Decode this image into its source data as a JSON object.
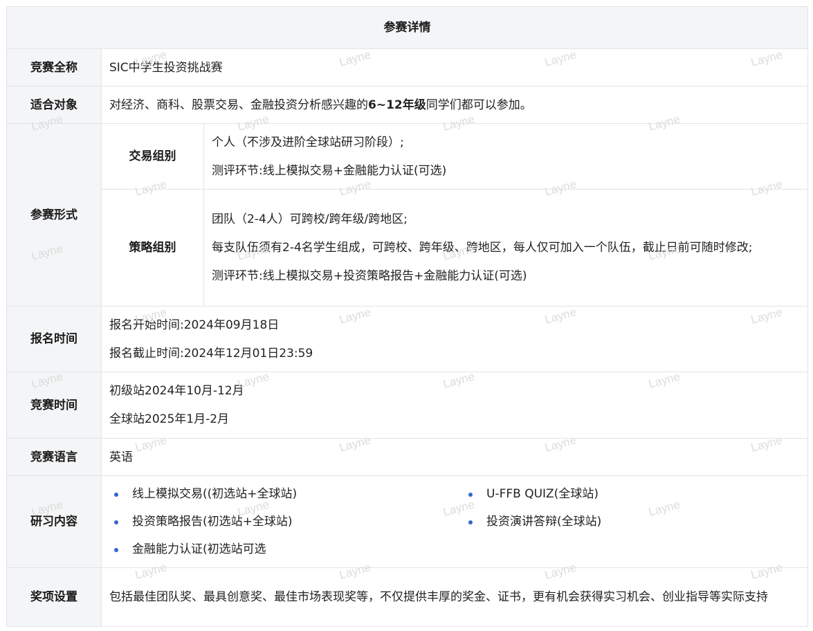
{
  "title": "参赛详情",
  "rows": {
    "name": {
      "label": "竞赛全称",
      "value": "SIC中学生投资挑战赛"
    },
    "audience": {
      "label": "适合对象",
      "before": "对经济、商科、股票交易、金融投资分析感兴趣的",
      "bold": "6~12年级",
      "after": "同学们都可以参加。"
    },
    "format": {
      "label": "参赛形式",
      "groups": [
        {
          "name": "交易组别",
          "lines": [
            "个人（不涉及进阶全球站研习阶段）;",
            "测评环节:线上模拟交易+金融能力认证(可选)"
          ]
        },
        {
          "name": "策略组别",
          "lines": [
            "团队（2-4人）可跨校/跨年级/跨地区;",
            "每支队伍须有2-4名学生组成，可跨校、跨年级、跨地区，每人仅可加入一个队伍，截止日前可随时修改;",
            "测评环节:线上模拟交易+投资策略报告+金融能力认证(可选)"
          ]
        }
      ]
    },
    "registration": {
      "label": "报名时间",
      "lines": [
        "报名开始时间:2024年09月18日",
        "报名截止时间:2024年12月01日23:59"
      ]
    },
    "schedule": {
      "label": "竞赛时间",
      "lines": [
        "初级站2024年10月-12月",
        "全球站2025年1月-2月"
      ]
    },
    "language": {
      "label": "竞赛语言",
      "value": "英语"
    },
    "content": {
      "label": "研习内容",
      "items": [
        "线上模拟交易((初选站+全球站)",
        "U-FFB QUIZ(全球站)",
        "投资策略报告(初选站+全球站)",
        "投资演讲答辩(全球站)",
        "金融能力认证(初选站可选"
      ]
    },
    "awards": {
      "label": "奖项设置",
      "value": "包括最佳团队奖、最具创意奖、最佳市场表现奖等，不仅提供丰厚的奖金、证书，更有机会获得实习机会、创业指导等实际支持"
    }
  },
  "watermark": "Layne",
  "colors": {
    "header_bg": "#f4f5f7",
    "border": "#e2e4e8",
    "bullet": "#3366cc"
  }
}
